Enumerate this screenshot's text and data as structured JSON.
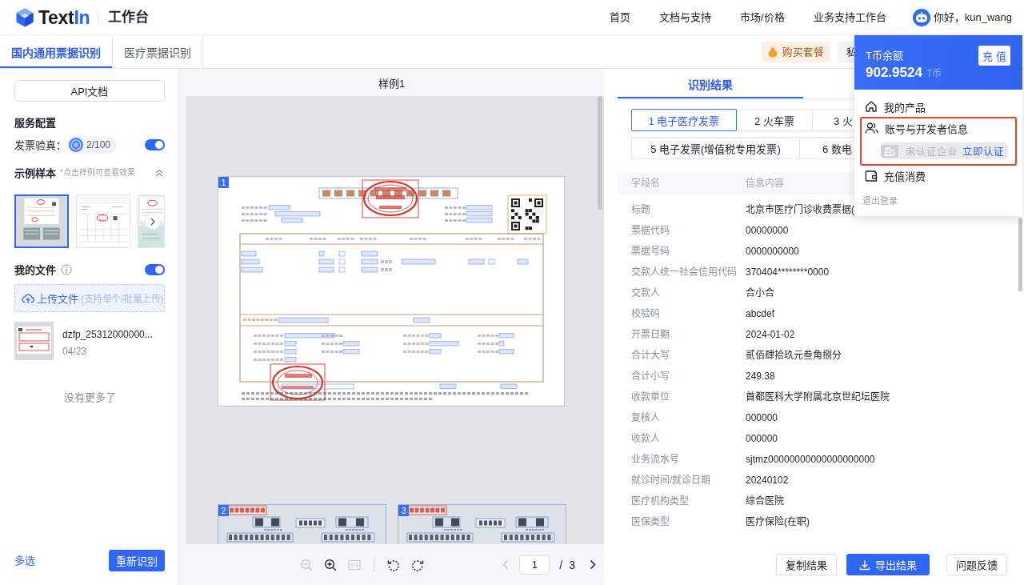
{
  "header": {
    "logo": {
      "text": "Text",
      "accent": "In"
    },
    "title": "工作台",
    "nav": [
      {
        "label": "首页"
      },
      {
        "label": "文档与支持"
      },
      {
        "label": "市场/价格"
      },
      {
        "label": "业务支持工作台"
      }
    ],
    "user": {
      "greeting": "你好，kun_wang"
    }
  },
  "tabs": [
    {
      "label": "国内通用票据识别",
      "selected": true
    },
    {
      "label": "医疗票据识别",
      "selected": false
    }
  ],
  "actions_bar": [
    {
      "label": "购买套餐",
      "kind": "purchase"
    },
    {
      "label": "私",
      "kind": "plain"
    }
  ],
  "sidebar": {
    "api_button": "API文档",
    "service": {
      "heading": "服务配置",
      "verify_label": "发票验真：",
      "quota": "2/100",
      "on": true
    },
    "samples": {
      "heading": "示例样本",
      "hint": "*点击样例可查看效果",
      "expanded": true,
      "items": [
        {
          "kind": "invoice-set",
          "selected": true
        },
        {
          "kind": "vat-invoice",
          "selected": false
        },
        {
          "kind": "receipt",
          "selected": false
        }
      ]
    },
    "files": {
      "heading": "我的文件",
      "on": true,
      "upload": {
        "label": "上传文件",
        "hint": "(支持单个/批量上传)"
      },
      "items": [
        {
          "name": "dzfp_25312000000...",
          "date": "04/23"
        }
      ],
      "end_note": "没有更多了"
    },
    "footer": {
      "multi_select": "多选",
      "rerun": "重新识别"
    }
  },
  "viewer": {
    "title": "样例1",
    "pages": [
      {
        "number": "1",
        "kind": "invoice"
      },
      {
        "number": "2",
        "kind": "train-ticket"
      },
      {
        "number": "3",
        "kind": "train-ticket"
      }
    ],
    "tools": [
      {
        "kind": "zoom-out",
        "disabled": true
      },
      {
        "kind": "zoom-in",
        "disabled": false
      },
      {
        "kind": "fit",
        "disabled": true
      },
      {
        "kind": "rotate-left",
        "disabled": false
      },
      {
        "kind": "rotate-right",
        "disabled": false
      }
    ],
    "pagination": {
      "prev_disabled": true,
      "current": "1",
      "separator": "/",
      "total": "3",
      "next_disabled": false
    }
  },
  "results": {
    "tabs": [
      {
        "label": "识别结果",
        "selected": true
      }
    ],
    "doc_type_rows": [
      [
        {
          "label": "1 电子医疗发票",
          "selected": true
        },
        {
          "label": "2 火车票",
          "selected": false
        },
        {
          "label": "3 火",
          "selected": false
        }
      ],
      [
        {
          "label": "5 电子发票(增值税专用发票)",
          "selected": false
        },
        {
          "label": "6 数电",
          "selected": false
        }
      ]
    ],
    "table": {
      "columns": [
        "字段名",
        "信息内容"
      ],
      "rows": [
        {
          "field": "标题",
          "value": "北京市医疗门诊收费票据("
        },
        {
          "field": "票据代码",
          "value": "00000000"
        },
        {
          "field": "票据号码",
          "value": "0000000000"
        },
        {
          "field": "交款人统一社会信用代码",
          "value": "370404********0000"
        },
        {
          "field": "交款人",
          "value": "合小合"
        },
        {
          "field": "校验码",
          "value": "abcdef"
        },
        {
          "field": "开票日期",
          "value": "2024-01-02"
        },
        {
          "field": "合计大写",
          "value": "贰佰肆拾玖元叁角捌分"
        },
        {
          "field": "合计小写",
          "value": "249.38"
        },
        {
          "field": "收款单位",
          "value": "首都医科大学附属北京世纪坛医院"
        },
        {
          "field": "复核人",
          "value": "000000"
        },
        {
          "field": "收款人",
          "value": "000000"
        },
        {
          "field": "业务流水号",
          "value": "sjtmz00000000000000000000"
        },
        {
          "field": "就诊时间/就诊日期",
          "value": "20240102"
        },
        {
          "field": "医疗机构类型",
          "value": "综合医院"
        },
        {
          "field": "医保类型",
          "value": "医疗保险(在职)"
        }
      ]
    },
    "buttons": [
      {
        "label": "复制结果",
        "kind": "default"
      },
      {
        "label": "导出结果",
        "kind": "primary"
      },
      {
        "label": "问题反馈",
        "kind": "default"
      }
    ]
  },
  "account_menu": {
    "balance_label": "T币余额",
    "balance": "902.9524",
    "unit": "T币",
    "recharge": "充 值",
    "items": [
      {
        "kind": "products",
        "label": "我的产品",
        "highlighted": false
      },
      {
        "kind": "account",
        "label": "账号与开发者信息",
        "highlighted": true,
        "sub": {
          "status": "未认证企业",
          "action": "立即认证"
        }
      },
      {
        "kind": "billing",
        "label": "充值消费",
        "highlighted": false
      },
      {
        "kind": "logout",
        "label": "退出登录",
        "highlighted": false
      }
    ]
  }
}
